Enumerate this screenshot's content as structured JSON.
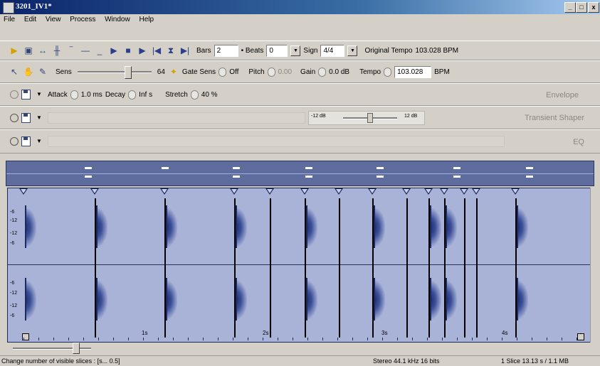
{
  "window": {
    "title": "3201_IV1*",
    "min_label": "_",
    "max_label": "□",
    "close_label": "x"
  },
  "menu": [
    "File",
    "Edit",
    "View",
    "Process",
    "Window",
    "Help"
  ],
  "toolbar1": {
    "bars_label": "Bars",
    "bars_value": "2",
    "beats_label": "• Beats",
    "beats_value": "0",
    "sign_label": "Sign",
    "sign_value": "4/4",
    "original_tempo_label": "Original Tempo",
    "original_tempo_value": "103.028 BPM"
  },
  "toolbar2": {
    "sens_label": "Sens",
    "sens_value": "64",
    "gate_sens_label": "Gate Sens",
    "gate_sens_value": "Off",
    "pitch_label": "Pitch",
    "pitch_value": "0.00",
    "gain_label": "Gain",
    "gain_value": "0.0 dB",
    "tempo_label": "Tempo",
    "tempo_value": "103.028",
    "bpm_label": "BPM"
  },
  "toolbar3": {
    "attack_label": "Attack",
    "attack_value": "1.0 ms",
    "decay_label": "Decay",
    "decay_value": "Inf s",
    "stretch_label": "Stretch",
    "stretch_value": "40 %",
    "panel_label": "Envelope"
  },
  "toolbar4": {
    "left_db": "-12 dB",
    "right_db": "12 dB",
    "panel_label": "Transient Shaper"
  },
  "toolbar5": {
    "panel_label": "EQ"
  },
  "waveform": {
    "db_labels": [
      "-6",
      "-12",
      "-12",
      "-6",
      "-6",
      "-12",
      "-12",
      "-6"
    ],
    "time_labels": [
      "1s",
      "2s",
      "3s",
      "4s"
    ]
  },
  "status": {
    "hint": "Change number of visible slices : [s... 0.5]",
    "format": "Stereo  44.1 kHz  16 bits",
    "slice_info": "1 Slice  13.13 s / 1.1 MB"
  }
}
